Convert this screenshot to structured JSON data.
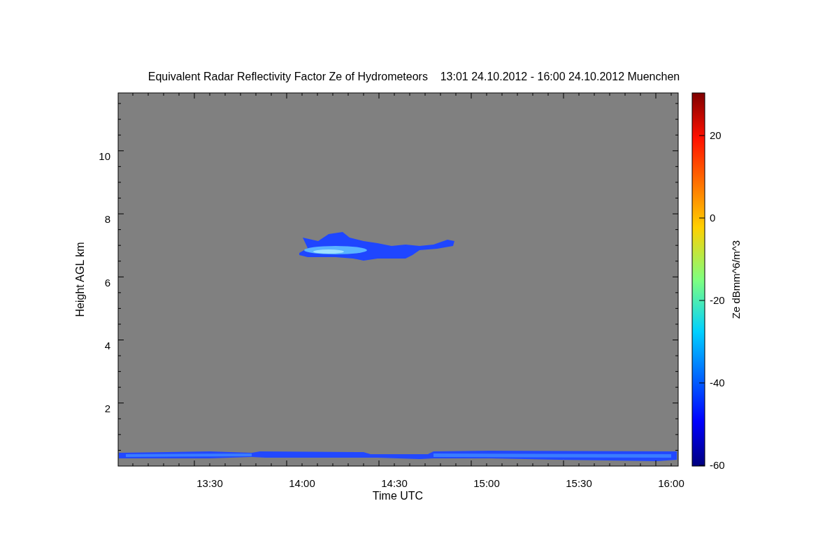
{
  "figure": {
    "plot": {
      "title": "Equivalent Radar Reflectivity Factor Ze of Hydrometeors    13:01 24.10.2012 - 16:00 24.10.2012 Muenchen",
      "xlabel": "Time UTC",
      "ylabel": "Height AGL km",
      "xtick_labels": [
        "13:30",
        "14:00",
        "14:30",
        "15:00",
        "15:30",
        "16:00"
      ],
      "ytick_labels": [
        "10",
        "8",
        "6",
        "4",
        "2"
      ]
    },
    "colorbar": {
      "label": "Ze dBmm^6/m^3",
      "tick_labels": [
        "20",
        "0",
        "-20",
        "-40",
        "-60"
      ]
    }
  }
}
